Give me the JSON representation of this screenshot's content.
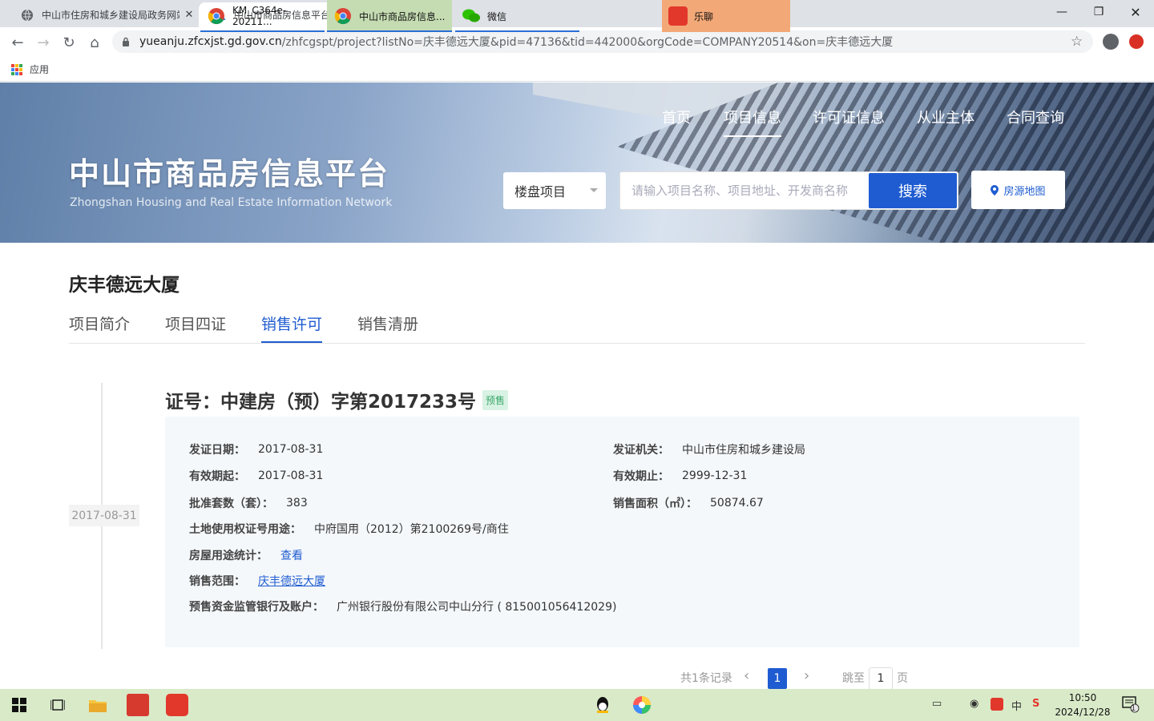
{
  "browser": {
    "tabs": [
      {
        "title": "中山市住房和城乡建设局政务网站",
        "active": false
      },
      {
        "title": "中山市商品房信息平台",
        "active": true
      }
    ],
    "url_host": "yueanju.zfcxjst.gd.gov.cn",
    "url_path": "/zhfcgspt/project?listNo=庆丰德远大厦&pid=47136&tid=442000&orgCode=COMPANY20514&on=庆丰德远大厦",
    "bookmarks_apps": "应用"
  },
  "header": {
    "site_title": "中山市商品房信息平台",
    "site_subtitle": "Zhongshan Housing and Real Estate Information Network",
    "nav": [
      "首页",
      "项目信息",
      "许可证信息",
      "从业主体",
      "合同查询"
    ],
    "active_nav": "项目信息",
    "select_value": "楼盘项目",
    "search_placeholder": "请输入项目名称、项目地址、开发商名称",
    "search_button": "搜索",
    "map_button": "房源地图"
  },
  "project": {
    "title": "庆丰德远大厦",
    "tabs": [
      "项目简介",
      "项目四证",
      "销售许可",
      "销售清册"
    ],
    "active_tab": "销售许可"
  },
  "permit": {
    "date_badge": "2017-08-31",
    "cert_title": "证号：中建房（预）字第2017233号",
    "cert_tag": "预售",
    "fields": {
      "issue_date_label": "发证日期：",
      "issue_date": "2017-08-31",
      "issuer_label": "发证机关：",
      "issuer": "中山市住房和城乡建设局",
      "valid_from_label": "有效期起：",
      "valid_from": "2017-08-31",
      "valid_to_label": "有效期止：",
      "valid_to": "2999-12-31",
      "units_label": "批准套数（套）：",
      "units": "383",
      "area_label": "销售面积（㎡）：",
      "area": "50874.67",
      "land_label": "土地使用权证号用途：",
      "land": "中府国用（2012）第2100269号/商住",
      "usage_label": "房屋用途统计：",
      "usage_link": "查看",
      "scope_label": "销售范围：",
      "scope_link": "庆丰德远大厦",
      "bank_label": "预售资金监管银行及账户：",
      "bank": "广州银行股份有限公司中山分行 ( 815001056412029)"
    }
  },
  "pagination": {
    "total": "共1条记录",
    "prev": "‹",
    "current": "1",
    "next": "›",
    "jump_label": "跳至",
    "jump_value": "1",
    "page_suffix": "页"
  },
  "taskbar": {
    "items": [
      "KM_C364e-20211...",
      "中山市商品房信息...",
      "微信",
      "乐聊"
    ],
    "time": "10:50",
    "date": "2024/12/28",
    "ime": "中",
    "notif_count": "1"
  },
  "colors": {
    "accent": "#1f5cd1",
    "tag_green": "#3aa86b",
    "taskbar": "#d9eac8"
  }
}
